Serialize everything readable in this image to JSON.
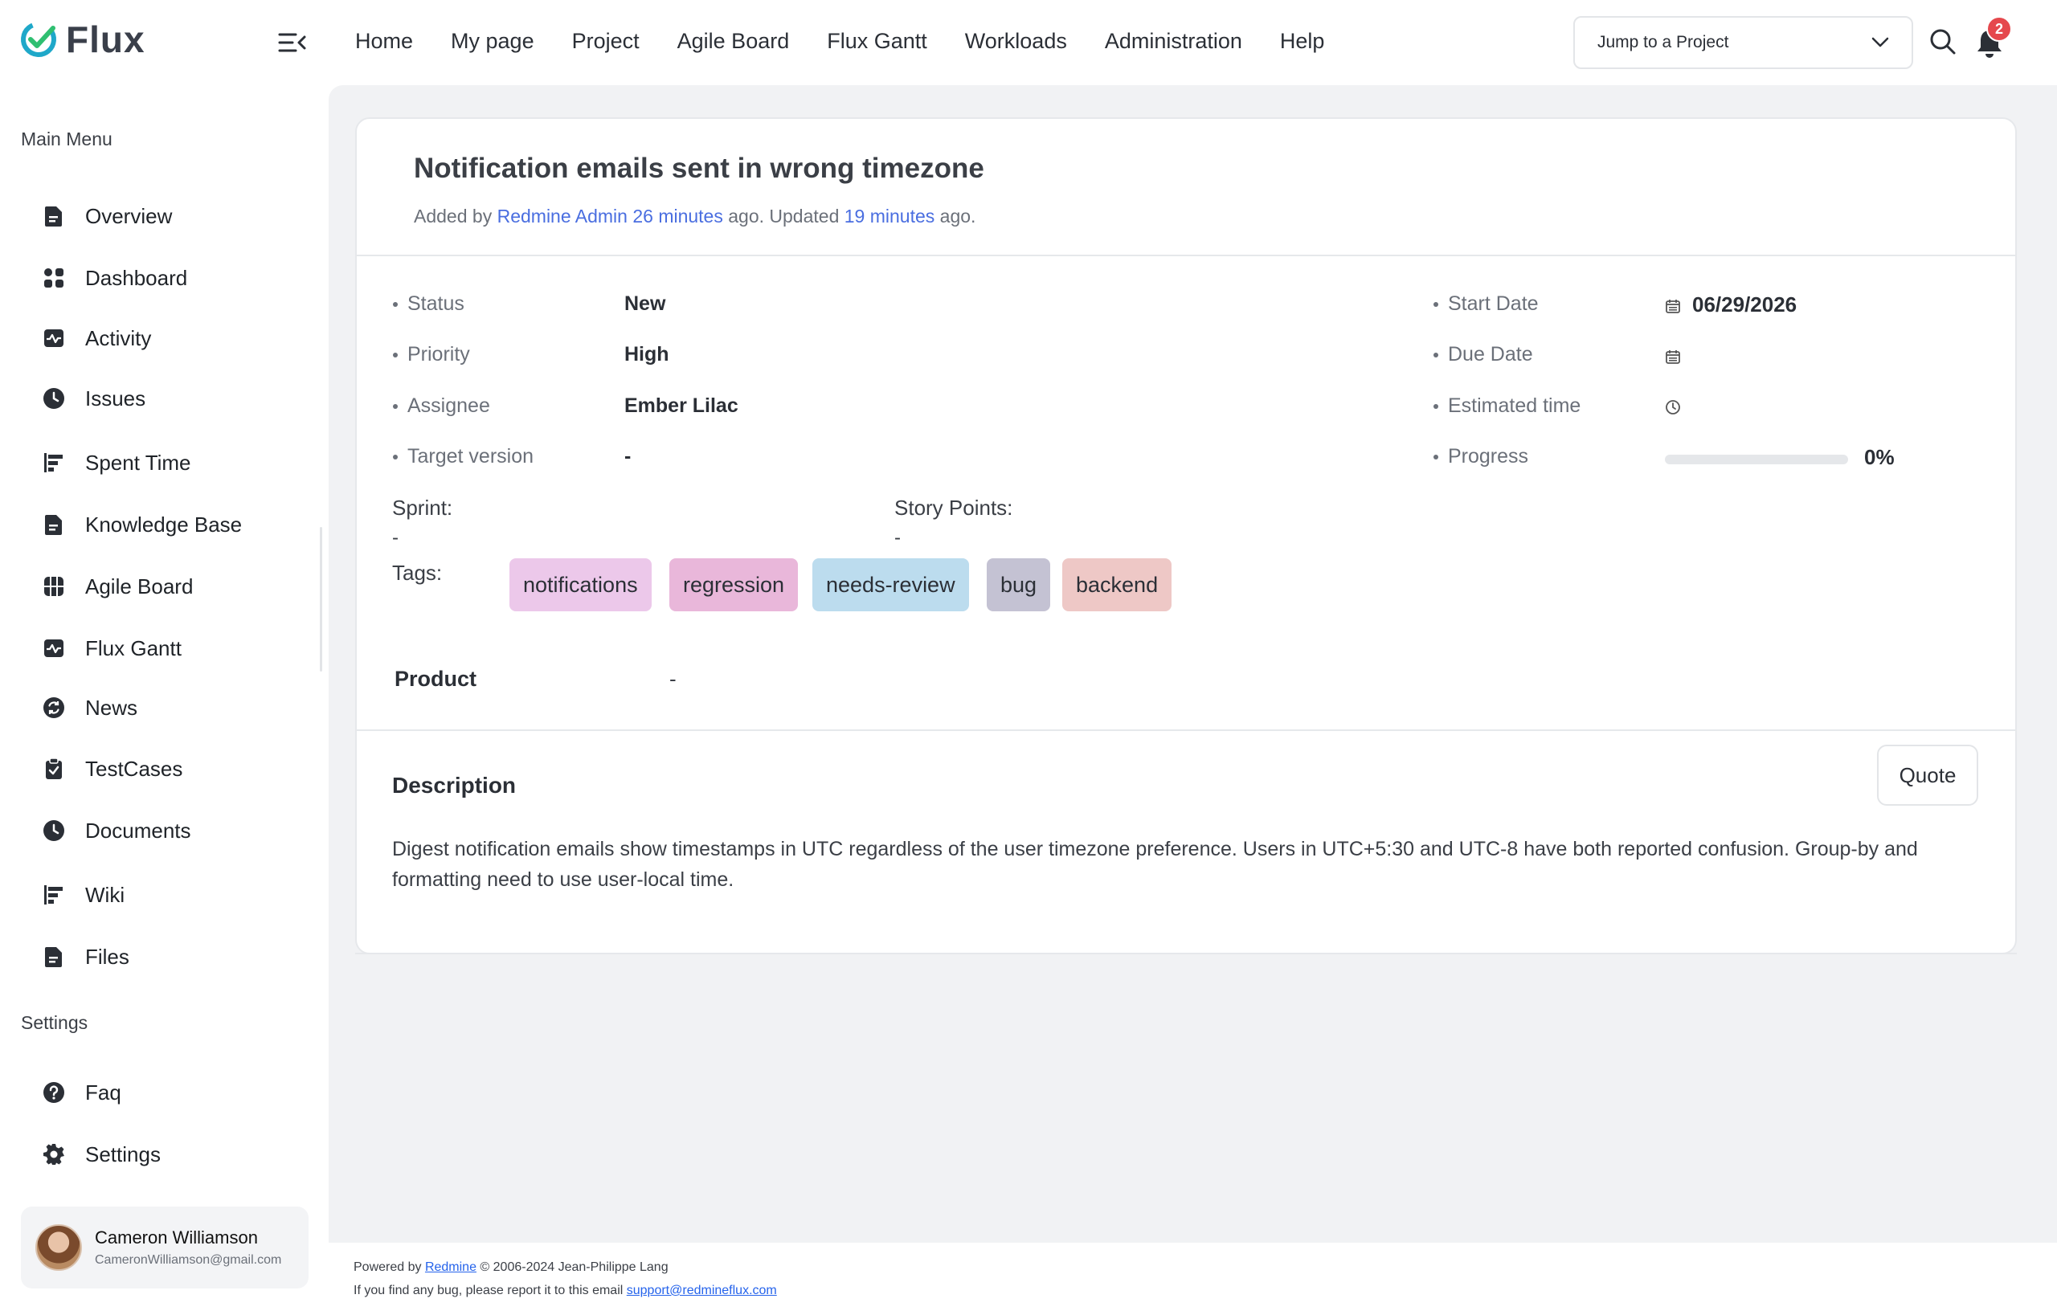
{
  "app": {
    "logo_text": "Flux",
    "brand_color": "#1fa8c9",
    "accent_color": "#4a6ee0"
  },
  "topnav": {
    "items": [
      "Home",
      "My page",
      "Project",
      "Agile Board",
      "Flux Gantt",
      "Workloads",
      "Administration",
      "Help"
    ],
    "jump_placeholder": "Jump to a Project",
    "notification_count": "2"
  },
  "sidebar": {
    "main_menu_title": "Main Menu",
    "items": [
      {
        "label": "Overview",
        "icon": "document-icon"
      },
      {
        "label": "Dashboard",
        "icon": "dashboard-icon"
      },
      {
        "label": "Activity",
        "icon": "activity-icon"
      },
      {
        "label": "Issues",
        "icon": "clock-icon"
      },
      {
        "label": "Spent Time",
        "icon": "gantt-bars-icon"
      },
      {
        "label": "Knowledge Base",
        "icon": "document-icon"
      },
      {
        "label": "Agile Board",
        "icon": "board-icon"
      },
      {
        "label": "Flux Gantt",
        "icon": "activity-icon"
      },
      {
        "label": "News",
        "icon": "refresh-icon"
      },
      {
        "label": "TestCases",
        "icon": "clipboard-check-icon"
      },
      {
        "label": "Documents",
        "icon": "clock-icon"
      },
      {
        "label": "Wiki",
        "icon": "gantt-bars-icon"
      },
      {
        "label": "Files",
        "icon": "document-icon"
      }
    ],
    "settings_title": "Settings",
    "settings_items": [
      {
        "label": "Faq",
        "icon": "help-circle-icon"
      },
      {
        "label": "Settings",
        "icon": "gear-icon"
      }
    ],
    "user": {
      "name": "Cameron Williamson",
      "email": "CameronWilliamson@gmail.com"
    }
  },
  "issue": {
    "title": "Notification emails sent in wrong timezone",
    "meta": {
      "added_prefix": "Added by ",
      "author": "Redmine Admin",
      "created_ago": "26 minutes",
      "updated_prefix": " ago. Updated ",
      "updated_ago": "19 minutes",
      "suffix": " ago."
    },
    "attributes_left": [
      {
        "label": "Status",
        "value": "New"
      },
      {
        "label": "Priority",
        "value": "High"
      },
      {
        "label": "Assignee",
        "value": "Ember Lilac"
      },
      {
        "label": "Target version",
        "value": "-"
      }
    ],
    "attributes_right": [
      {
        "label": "Start Date",
        "value": "06/29/2026"
      },
      {
        "label": "Due Date",
        "value": ""
      },
      {
        "label": "Estimated time",
        "value": ""
      },
      {
        "label": "Progress",
        "value": "0%"
      }
    ],
    "progress_fraction": 0,
    "sprint_label": "Sprint:",
    "sprint_value": "-",
    "story_points_label": "Story Points:",
    "story_points_value": "-",
    "tags_label": "Tags:",
    "tags": [
      {
        "label": "notifications",
        "color": "#ecc8ea"
      },
      {
        "label": "regression",
        "color": "#e9b7da"
      },
      {
        "label": "needs-review",
        "color": "#bcdcee"
      },
      {
        "label": "bug",
        "color": "#c4c2d3"
      },
      {
        "label": "backend",
        "color": "#eec8c6"
      }
    ],
    "product_label": "Product",
    "product_value": "-",
    "description_title": "Description",
    "quote_label": "Quote",
    "description": "Digest notification emails show timestamps in UTC regardless of the user timezone preference. Users in UTC+5:30 and UTC-8 have both reported confusion. Group-by and formatting need to use user-local time."
  },
  "footer": {
    "powered_prefix": "Powered by ",
    "powered_link": "Redmine",
    "powered_suffix": " © 2006-2024 Jean-Philippe Lang",
    "bug_prefix": "If you find any bug, please report it to this email ",
    "bug_email": "support@redmineflux.com"
  }
}
